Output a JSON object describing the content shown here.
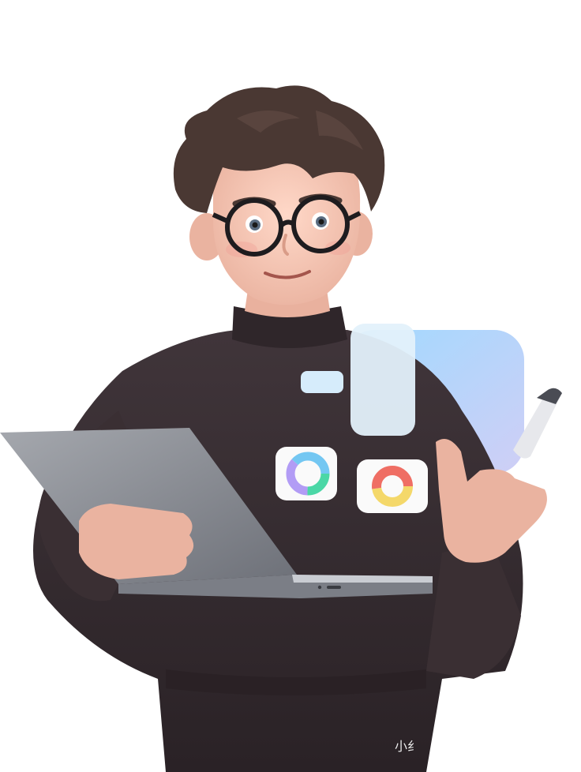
{
  "scene": {
    "description_colors": {
      "background": "#ffffff",
      "sweater": "#3a2f33",
      "hair": "#4a3833",
      "skin": "#f3c4b3",
      "glasses": "#1e1c1f",
      "laptop": "#8e9198",
      "panel": "#b9dcf6"
    },
    "icons": [
      "laptop-icon",
      "donut-chart-icon",
      "pie-chart-icon",
      "stylus-icon"
    ]
  },
  "watermark": {
    "text": "小纟"
  }
}
